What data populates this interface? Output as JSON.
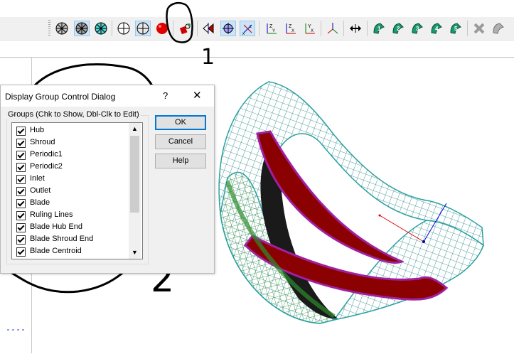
{
  "toolbar": {
    "buttons": [
      {
        "name": "view-hatched-icon",
        "active": false
      },
      {
        "name": "view-hatched-active-icon",
        "active": true
      },
      {
        "name": "view-wheel-cyan-icon",
        "active": false
      },
      {
        "name": "crosshair-circle-icon",
        "active": false
      },
      {
        "name": "crosshair-circle-active-icon",
        "active": true
      },
      {
        "name": "red-sphere-icon",
        "active": false
      },
      {
        "name": "display-groups-icon",
        "active": false
      },
      {
        "name": "blade-flip-icon",
        "active": false
      },
      {
        "name": "target-active-icon",
        "active": true
      },
      {
        "name": "axes-zx-active-icon",
        "active": true
      },
      {
        "name": "axis-zy-icon",
        "active": false
      },
      {
        "name": "axis-zx-icon",
        "active": false
      },
      {
        "name": "axis-yx-icon",
        "active": false
      },
      {
        "name": "axis-triad-icon",
        "active": false
      },
      {
        "name": "double-arrow-icon",
        "active": false
      },
      {
        "name": "blade-1-icon",
        "active": false
      },
      {
        "name": "blade-2-icon",
        "active": false
      },
      {
        "name": "blade-3-icon",
        "active": false
      },
      {
        "name": "blade-4-icon",
        "active": false
      },
      {
        "name": "blade-5-icon",
        "active": false
      },
      {
        "name": "blade-disabled-icon",
        "active": false
      },
      {
        "name": "blade-overflow-icon",
        "active": false
      }
    ],
    "axis_labels": {
      "zy": "Z Y",
      "zx": "Z X",
      "yx": "Y X"
    }
  },
  "dialog": {
    "title": "Display Group Control Dialog",
    "help_glyph": "?",
    "close_glyph": "✕",
    "group_label": "Groups (Chk to Show, Dbl-Clk to Edit)",
    "items": [
      {
        "label": "Hub",
        "checked": true
      },
      {
        "label": "Shroud",
        "checked": true
      },
      {
        "label": "Periodic1",
        "checked": true
      },
      {
        "label": "Periodic2",
        "checked": true
      },
      {
        "label": "Inlet",
        "checked": true
      },
      {
        "label": "Outlet",
        "checked": true
      },
      {
        "label": "Blade",
        "checked": true
      },
      {
        "label": "Ruling Lines",
        "checked": true
      },
      {
        "label": "Blade Hub End",
        "checked": true
      },
      {
        "label": "Blade Shroud End",
        "checked": true
      },
      {
        "label": "Blade Centroid",
        "checked": true
      }
    ],
    "buttons": {
      "ok": "OK",
      "cancel": "Cancel",
      "help": "Help"
    }
  },
  "annotations": {
    "mark_1": "1",
    "mark_2": "2"
  },
  "colors": {
    "toolbar_bg": "#f0f0f0",
    "active_button": "#cce4f7",
    "mesh_teal": "#2a9d9d",
    "mesh_green": "#2e8b2e",
    "blade_dark": "#1a1a1a",
    "blade_red": "#8b0000",
    "blade_magenta": "#a020a0"
  }
}
